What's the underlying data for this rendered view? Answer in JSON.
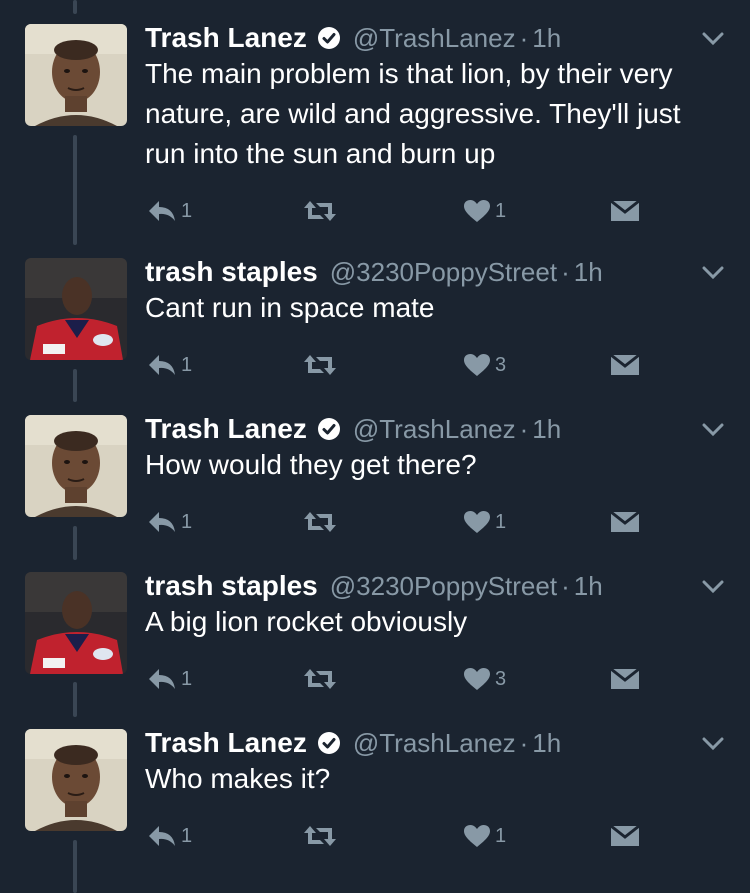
{
  "tweets": [
    {
      "author": "Trash Lanez",
      "verified": true,
      "handle": "@TrashLanez",
      "time": "1h",
      "text": "The main problem is that lion, by their very nature, are wild and aggressive. They'll just run into the sun and burn up",
      "reply_count": "1",
      "retweet_count": "",
      "like_count": "1",
      "avatar": "tory-avatar"
    },
    {
      "author": "trash staples",
      "verified": false,
      "handle": "@3230PoppyStreet",
      "time": "1h",
      "text": "Cant run in space mate",
      "reply_count": "1",
      "retweet_count": "",
      "like_count": "3",
      "avatar": "vince-avatar"
    },
    {
      "author": "Trash Lanez",
      "verified": true,
      "handle": "@TrashLanez",
      "time": "1h",
      "text": "How would they get there?",
      "reply_count": "1",
      "retweet_count": "",
      "like_count": "1",
      "avatar": "tory-avatar"
    },
    {
      "author": "trash staples",
      "verified": false,
      "handle": "@3230PoppyStreet",
      "time": "1h",
      "text": "A big lion rocket obviously",
      "reply_count": "1",
      "retweet_count": "",
      "like_count": "3",
      "avatar": "vince-avatar"
    },
    {
      "author": "Trash Lanez",
      "verified": true,
      "handle": "@TrashLanez",
      "time": "1h",
      "text": "Who makes it?",
      "reply_count": "1",
      "retweet_count": "",
      "like_count": "1",
      "avatar": "tory-avatar"
    }
  ],
  "separator": "·",
  "colors": {
    "background": "#1b2430",
    "secondary_text": "#8899a6",
    "thread_line": "#3a4654"
  }
}
